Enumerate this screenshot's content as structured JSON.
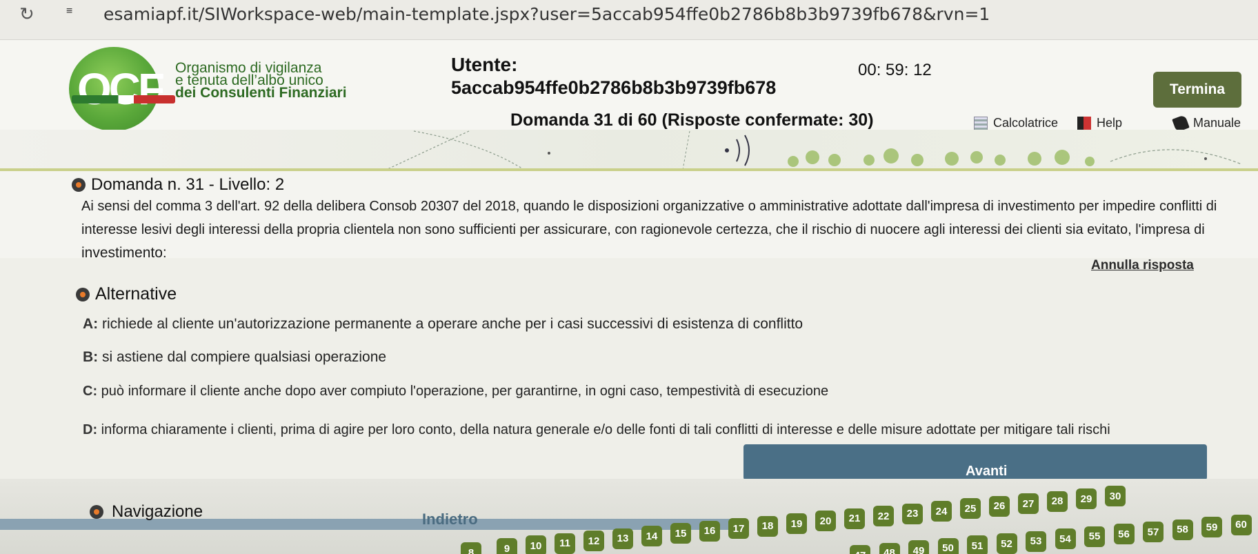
{
  "browser": {
    "reload_icon": "reload-icon",
    "site_info_icon": "site-info-icon",
    "url": "esamiapf.it/SIWorkspace-web/main-template.jspx?user=5accab954ffe0b2786b8b3b9739fb678&rvn=1"
  },
  "header": {
    "logo_text": "OCF",
    "org_line1": "Organismo di vigilanza",
    "org_line2": "e tenuta dell’albo unico",
    "org_line3": "dei Consulenti Finanziari",
    "user_label": "Utente:",
    "user_id": "5accab954ffe0b2786b8b3b9739fb678",
    "timer": "00: 59: 12",
    "termina_label": "Termina",
    "question_counter": "Domanda 31 di 60 (Risposte confermate: 30)",
    "tools": {
      "calc": "Calcolatrice",
      "help": "Help",
      "manual": "Manuale"
    }
  },
  "question": {
    "title": "Domanda n. 31 - Livello: 2",
    "line1": "Ai sensi del comma 3 dell'art. 92 della delibera Consob 20307 del 2018, quando le disposizioni organizzative o amministrative adottate dall'impresa di investimento per impedire conflitti di",
    "line2": "interesse lesivi degli interessi della propria clientela non sono sufficienti per assicurare, con ragionevole certezza, che il rischio di nuocere agli interessi dei clienti sia evitato, l'impresa di",
    "line3": "investimento:",
    "annulla": "Annulla risposta"
  },
  "alternatives": {
    "title": "Alternative",
    "items": [
      {
        "key": "A:",
        "text": " richiede al cliente un'autorizzazione permanente a operare anche per i casi successivi di esistenza di conflitto"
      },
      {
        "key": "B:",
        "text": " si astiene dal compiere qualsiasi operazione"
      },
      {
        "key": "C:",
        "text": " può informare il cliente anche dopo aver compiuto l'operazione, per garantirne, in ogni caso, tempestività di esecuzione"
      },
      {
        "key": "D:",
        "text": " informa chiaramente i clienti, prima di agire per loro conto, della natura generale e/o delle fonti di tali conflitti di interesse e delle misure adottate per mitigare tali rischi"
      }
    ]
  },
  "navigation": {
    "avanti": "Avanti",
    "title": "Navigazione",
    "indietro": "Indietro",
    "current_page": "31",
    "row1_pages": [
      "9",
      "10",
      "11",
      "12",
      "13",
      "14",
      "15",
      "16",
      "17",
      "18",
      "19",
      "20",
      "21",
      "22",
      "23",
      "24",
      "25",
      "26",
      "27",
      "28",
      "29",
      "30"
    ],
    "row2_pages": [
      "47",
      "48",
      "49",
      "50",
      "51",
      "52",
      "53",
      "54",
      "55",
      "56",
      "57",
      "58",
      "59",
      "60"
    ],
    "partial_page": "8"
  },
  "colors": {
    "termina_bg": "#5d6e3c",
    "page_button": "#5f7d2a",
    "nav_bar": "#4a6f86",
    "logo_green": "#5aa83a",
    "accent_orange": "#e87a2a"
  }
}
